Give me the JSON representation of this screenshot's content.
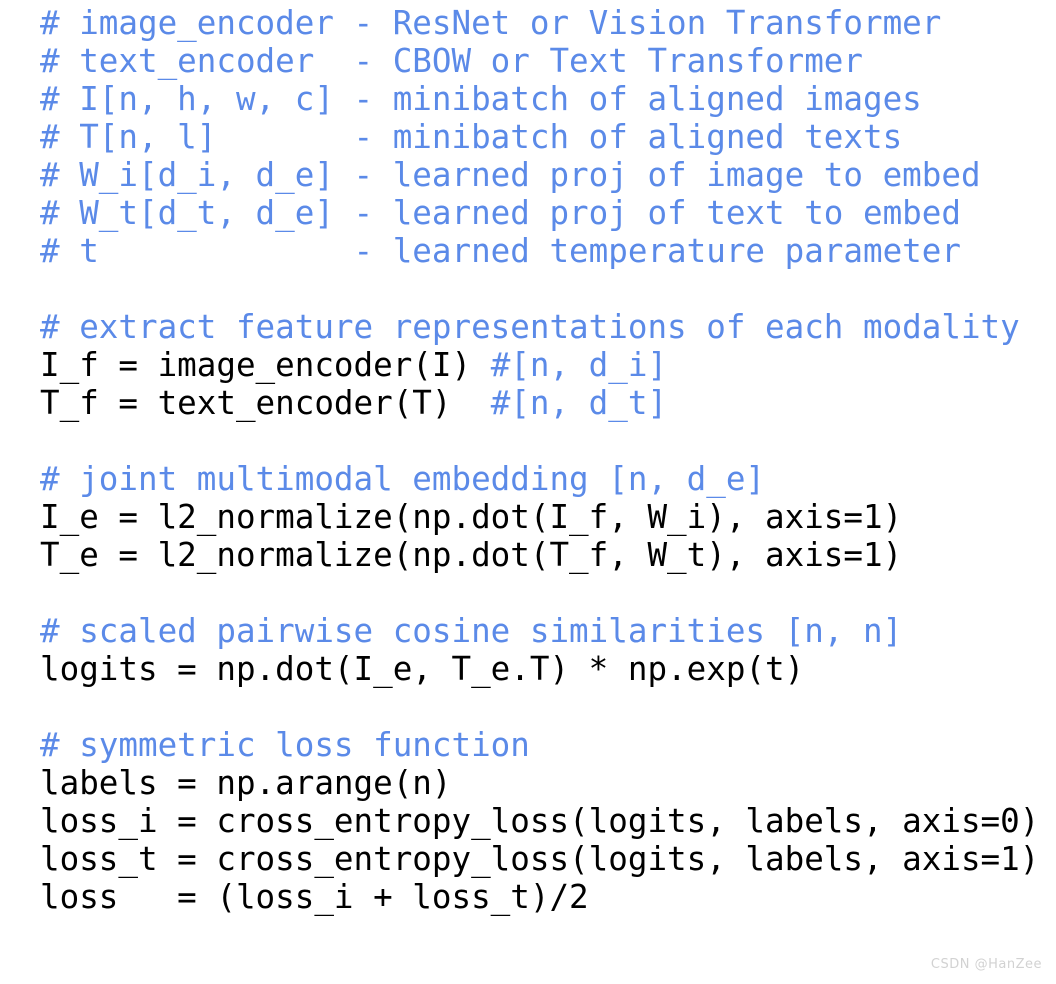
{
  "page": {
    "background_color": "#ffffff",
    "comment_color": "#5b8ae8",
    "code_color": "#000000",
    "watermark_color": "#d2d2d2",
    "title": "CLIP pseudocode listing"
  },
  "code": {
    "language": "python",
    "lines": [
      {
        "type": "comment",
        "text": "# image_encoder - ResNet or Vision Transformer"
      },
      {
        "type": "comment",
        "text": "# text_encoder  - CBOW or Text Transformer"
      },
      {
        "type": "comment",
        "text": "# I[n, h, w, c] - minibatch of aligned images"
      },
      {
        "type": "comment",
        "text": "# T[n, l]       - minibatch of aligned texts"
      },
      {
        "type": "comment",
        "text": "# W_i[d_i, d_e] - learned proj of image to embed"
      },
      {
        "type": "comment",
        "text": "# W_t[d_t, d_e] - learned proj of text to embed"
      },
      {
        "type": "comment",
        "text": "# t             - learned temperature parameter"
      },
      {
        "type": "blank",
        "text": ""
      },
      {
        "type": "comment",
        "text": "# extract feature representations of each modality"
      },
      {
        "type": "mixed",
        "code": "I_f = image_encoder(I) ",
        "comment": "#[n, d_i]"
      },
      {
        "type": "mixed",
        "code": "T_f = text_encoder(T)  ",
        "comment": "#[n, d_t]"
      },
      {
        "type": "blank",
        "text": ""
      },
      {
        "type": "comment",
        "text": "# joint multimodal embedding [n, d_e]"
      },
      {
        "type": "code",
        "text": "I_e = l2_normalize(np.dot(I_f, W_i), axis=1)"
      },
      {
        "type": "code",
        "text": "T_e = l2_normalize(np.dot(T_f, W_t), axis=1)"
      },
      {
        "type": "blank",
        "text": ""
      },
      {
        "type": "comment",
        "text": "# scaled pairwise cosine similarities [n, n]"
      },
      {
        "type": "code",
        "text": "logits = np.dot(I_e, T_e.T) * np.exp(t)"
      },
      {
        "type": "blank",
        "text": ""
      },
      {
        "type": "comment",
        "text": "# symmetric loss function"
      },
      {
        "type": "code",
        "text": "labels = np.arange(n)"
      },
      {
        "type": "code",
        "text": "loss_i = cross_entropy_loss(logits, labels, axis=0)"
      },
      {
        "type": "code",
        "text": "loss_t = cross_entropy_loss(logits, labels, axis=1)"
      },
      {
        "type": "code",
        "text": "loss   = (loss_i + loss_t)/2"
      }
    ]
  },
  "watermark": {
    "text": "CSDN @HanZee"
  }
}
